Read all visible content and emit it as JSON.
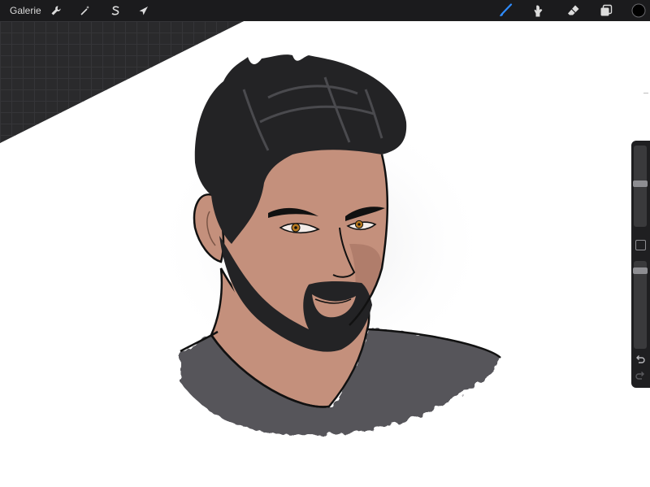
{
  "app": {
    "gallery_label": "Galerie"
  },
  "toolbar": {
    "left_tools": [
      {
        "name": "actions",
        "icon": "wrench-icon"
      },
      {
        "name": "adjustments",
        "icon": "magic-wand-icon"
      },
      {
        "name": "selection",
        "icon": "selection-s-icon"
      },
      {
        "name": "transform",
        "icon": "arrow-cursor-icon"
      }
    ],
    "right_tools": [
      {
        "name": "brush",
        "icon": "brush-icon",
        "active": true
      },
      {
        "name": "smudge",
        "icon": "smudge-icon"
      },
      {
        "name": "eraser",
        "icon": "eraser-icon"
      },
      {
        "name": "layers",
        "icon": "layers-icon"
      },
      {
        "name": "color",
        "icon": "color-swatch-icon",
        "color": "#000000"
      }
    ],
    "active_color": "#2f8cff"
  },
  "sidebar": {
    "brush_size_level": 0.45,
    "opacity_level": 0.08,
    "undo_icon": "undo-icon",
    "redo_icon": "redo-icon"
  },
  "colors": {
    "skin": "#c4907c",
    "hair": "#232325",
    "shirt": "#56545a",
    "iris": "#b7791f"
  }
}
